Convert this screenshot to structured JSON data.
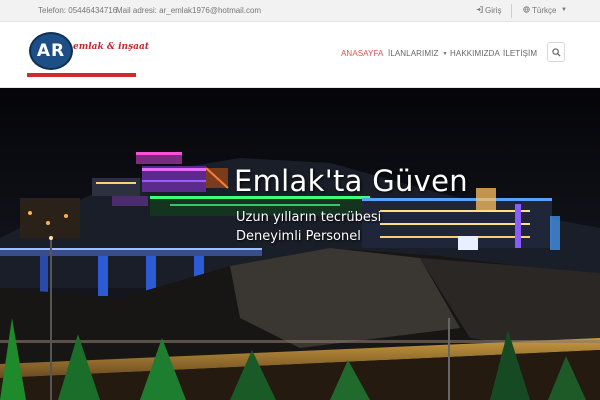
{
  "topbar": {
    "phone": "Telefon: 05446434716",
    "email": "Mail adresi: ar_emlak1976@hotmail.com",
    "login_label": "Giriş",
    "language_label": "Türkçe"
  },
  "logo": {
    "monogram": "AR",
    "tagline": "emlak & inşaat"
  },
  "nav": {
    "items": [
      {
        "label": "ANASAYFA"
      },
      {
        "label": "İLANLARIMIZ"
      },
      {
        "label": "HAKKIMIZDA"
      },
      {
        "label": "İLETİŞİM"
      }
    ]
  },
  "hero": {
    "title": "Emlak'ta Güven",
    "line1": "Uzun yılların tecrübesi",
    "line2": "Deneyimli Personel"
  },
  "colors": {
    "accent": "#e05050",
    "brand_blue": "#1d4f86",
    "brand_red": "#d02a2a"
  },
  "icons": [
    "login-icon",
    "globe-icon",
    "chevron-down-icon",
    "search-icon"
  ]
}
